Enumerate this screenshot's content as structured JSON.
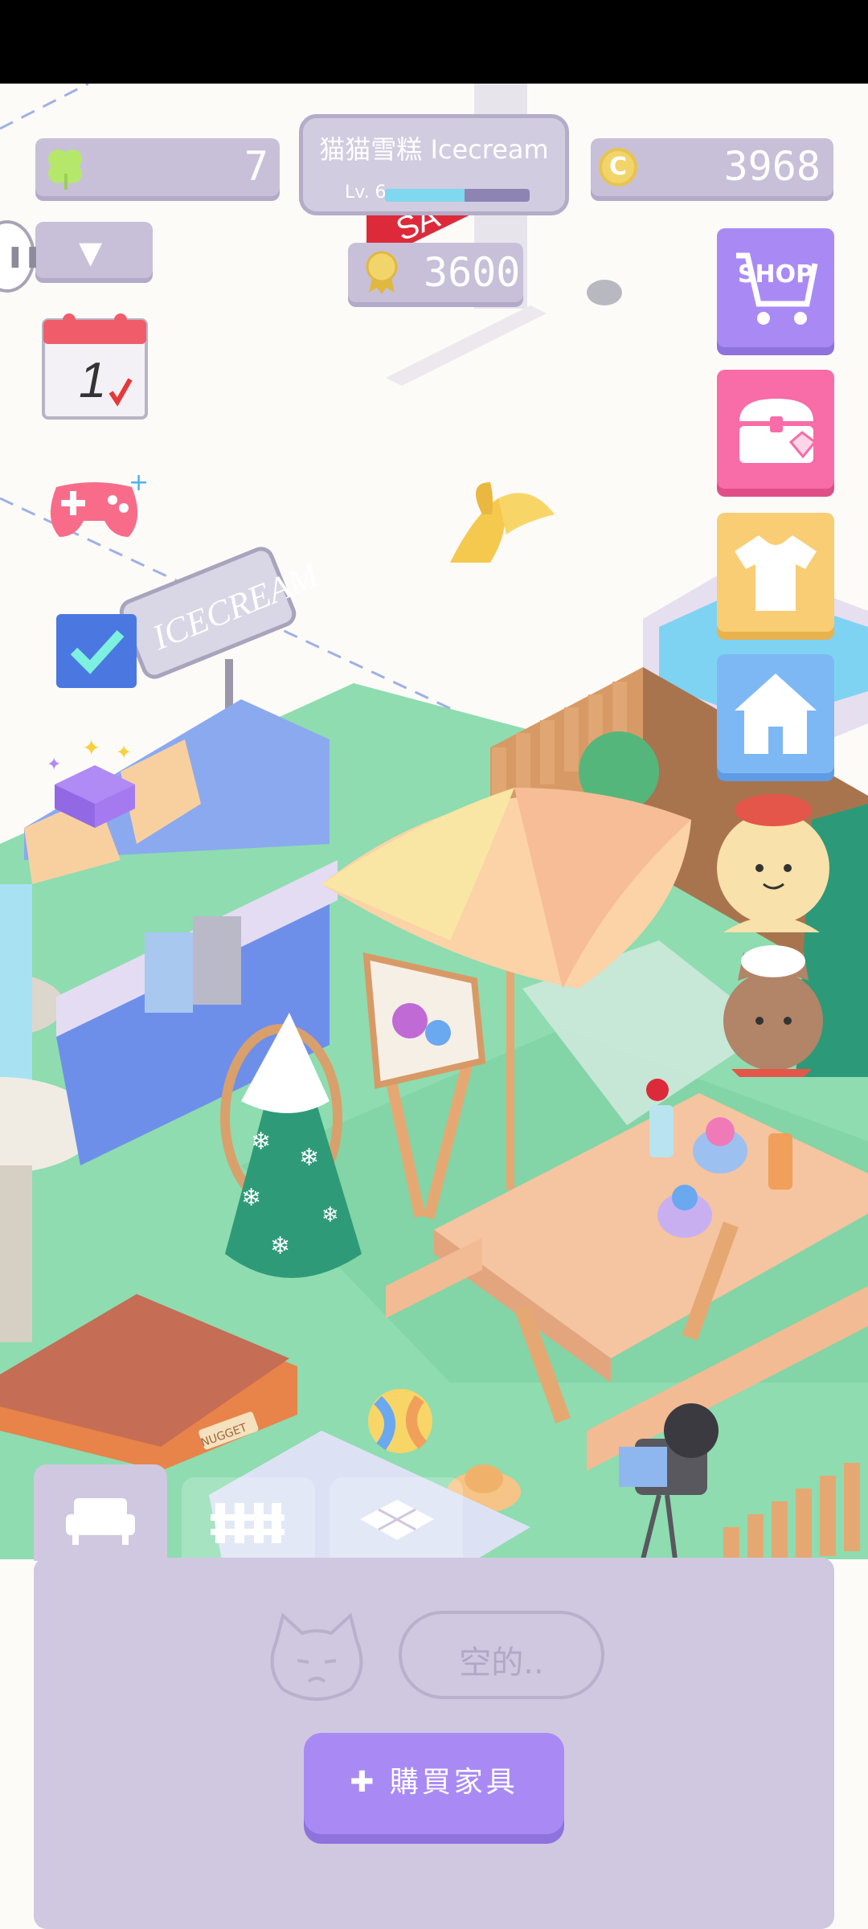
{
  "hud": {
    "clover_count": "7",
    "coin_count": "3968",
    "coin_symbol": "C",
    "shop_name": "猫猫雪糕 Icecream",
    "level_label": "Lv. 6",
    "xp_fraction": 0.55,
    "trophy_count": "3600"
  },
  "left_icons": {
    "calendar_day": "1"
  },
  "right_buttons": {
    "shop_label": "SHOP"
  },
  "scene": {
    "stall_sign": "ICECREAM",
    "sale_sign": "SA",
    "bed_tag": "NUGGET"
  },
  "bottom_panel": {
    "empty_text": "空的..",
    "buy_button": "購買家具"
  },
  "colors": {
    "hud_pill": "#c8c0d8",
    "shop_btn": "#a98af5",
    "chest_btn": "#f86ca7",
    "shirt_btn": "#f8cd74",
    "home_btn": "#7db8f5",
    "panel_bg": "#d0c8e0",
    "grass": "#8edcb0"
  },
  "icons": [
    "clover-icon",
    "coin-icon",
    "trophy-icon",
    "dropdown-chevron-icon",
    "calendar-icon",
    "gamepad-icon",
    "checklist-icon",
    "gift-box-icon",
    "shop-cart-icon",
    "treasure-chest-icon",
    "shirt-icon",
    "home-icon",
    "sofa-icon",
    "fence-icon",
    "tile-icon",
    "sad-cat-icon"
  ]
}
